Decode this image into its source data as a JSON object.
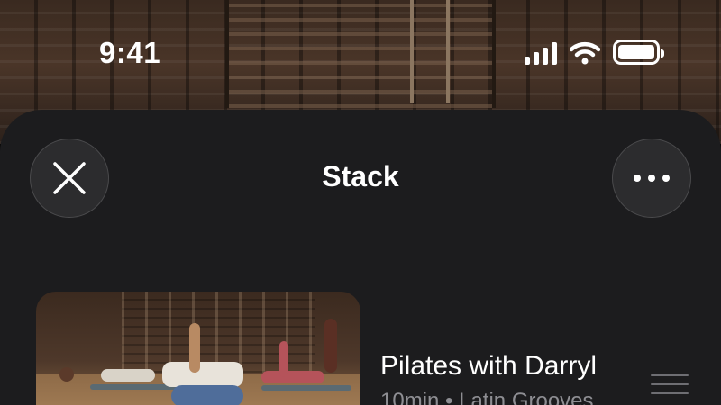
{
  "status_bar": {
    "time": "9:41",
    "icons": [
      "cellular-signal-icon",
      "wifi-icon",
      "battery-icon"
    ],
    "battery_level": 1.0
  },
  "sheet": {
    "title": "Stack",
    "close_icon": "close-icon",
    "more_icon": "more-icon"
  },
  "items": [
    {
      "title": "Pilates with Darryl",
      "subtitle": "10min • Latin Grooves",
      "handle_icon": "drag-handle-icon"
    }
  ],
  "colors": {
    "sheet_background": "#1c1c1e",
    "button_background": "#2c2c2e",
    "secondary_text": "#8e8e93",
    "primary_text": "#ffffff"
  }
}
